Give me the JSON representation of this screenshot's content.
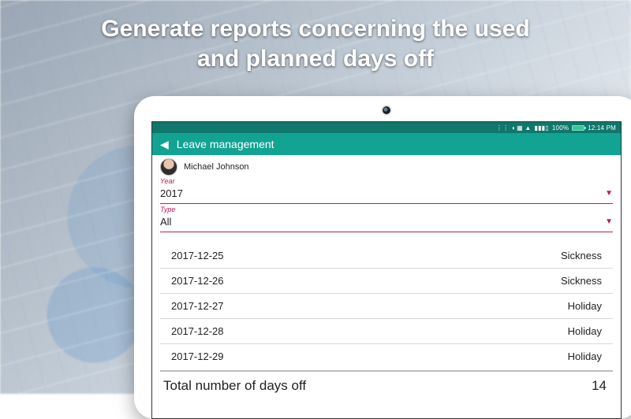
{
  "headline": {
    "line1": "Generate reports concerning the used",
    "line2": "and planned days off"
  },
  "statusbar": {
    "signal_text": "100%",
    "time": "12:14 PM"
  },
  "appbar": {
    "title": "Leave management"
  },
  "user": {
    "name": "Michael Johnson"
  },
  "filters": {
    "year": {
      "label": "Year",
      "value": "2017"
    },
    "type": {
      "label": "Type",
      "value": "All"
    }
  },
  "entries": [
    {
      "date": "2017-12-25",
      "kind": "Sickness"
    },
    {
      "date": "2017-12-26",
      "kind": "Sickness"
    },
    {
      "date": "2017-12-27",
      "kind": "Holiday"
    },
    {
      "date": "2017-12-28",
      "kind": "Holiday"
    },
    {
      "date": "2017-12-29",
      "kind": "Holiday"
    }
  ],
  "total": {
    "label": "Total number of days off",
    "value": "14"
  }
}
